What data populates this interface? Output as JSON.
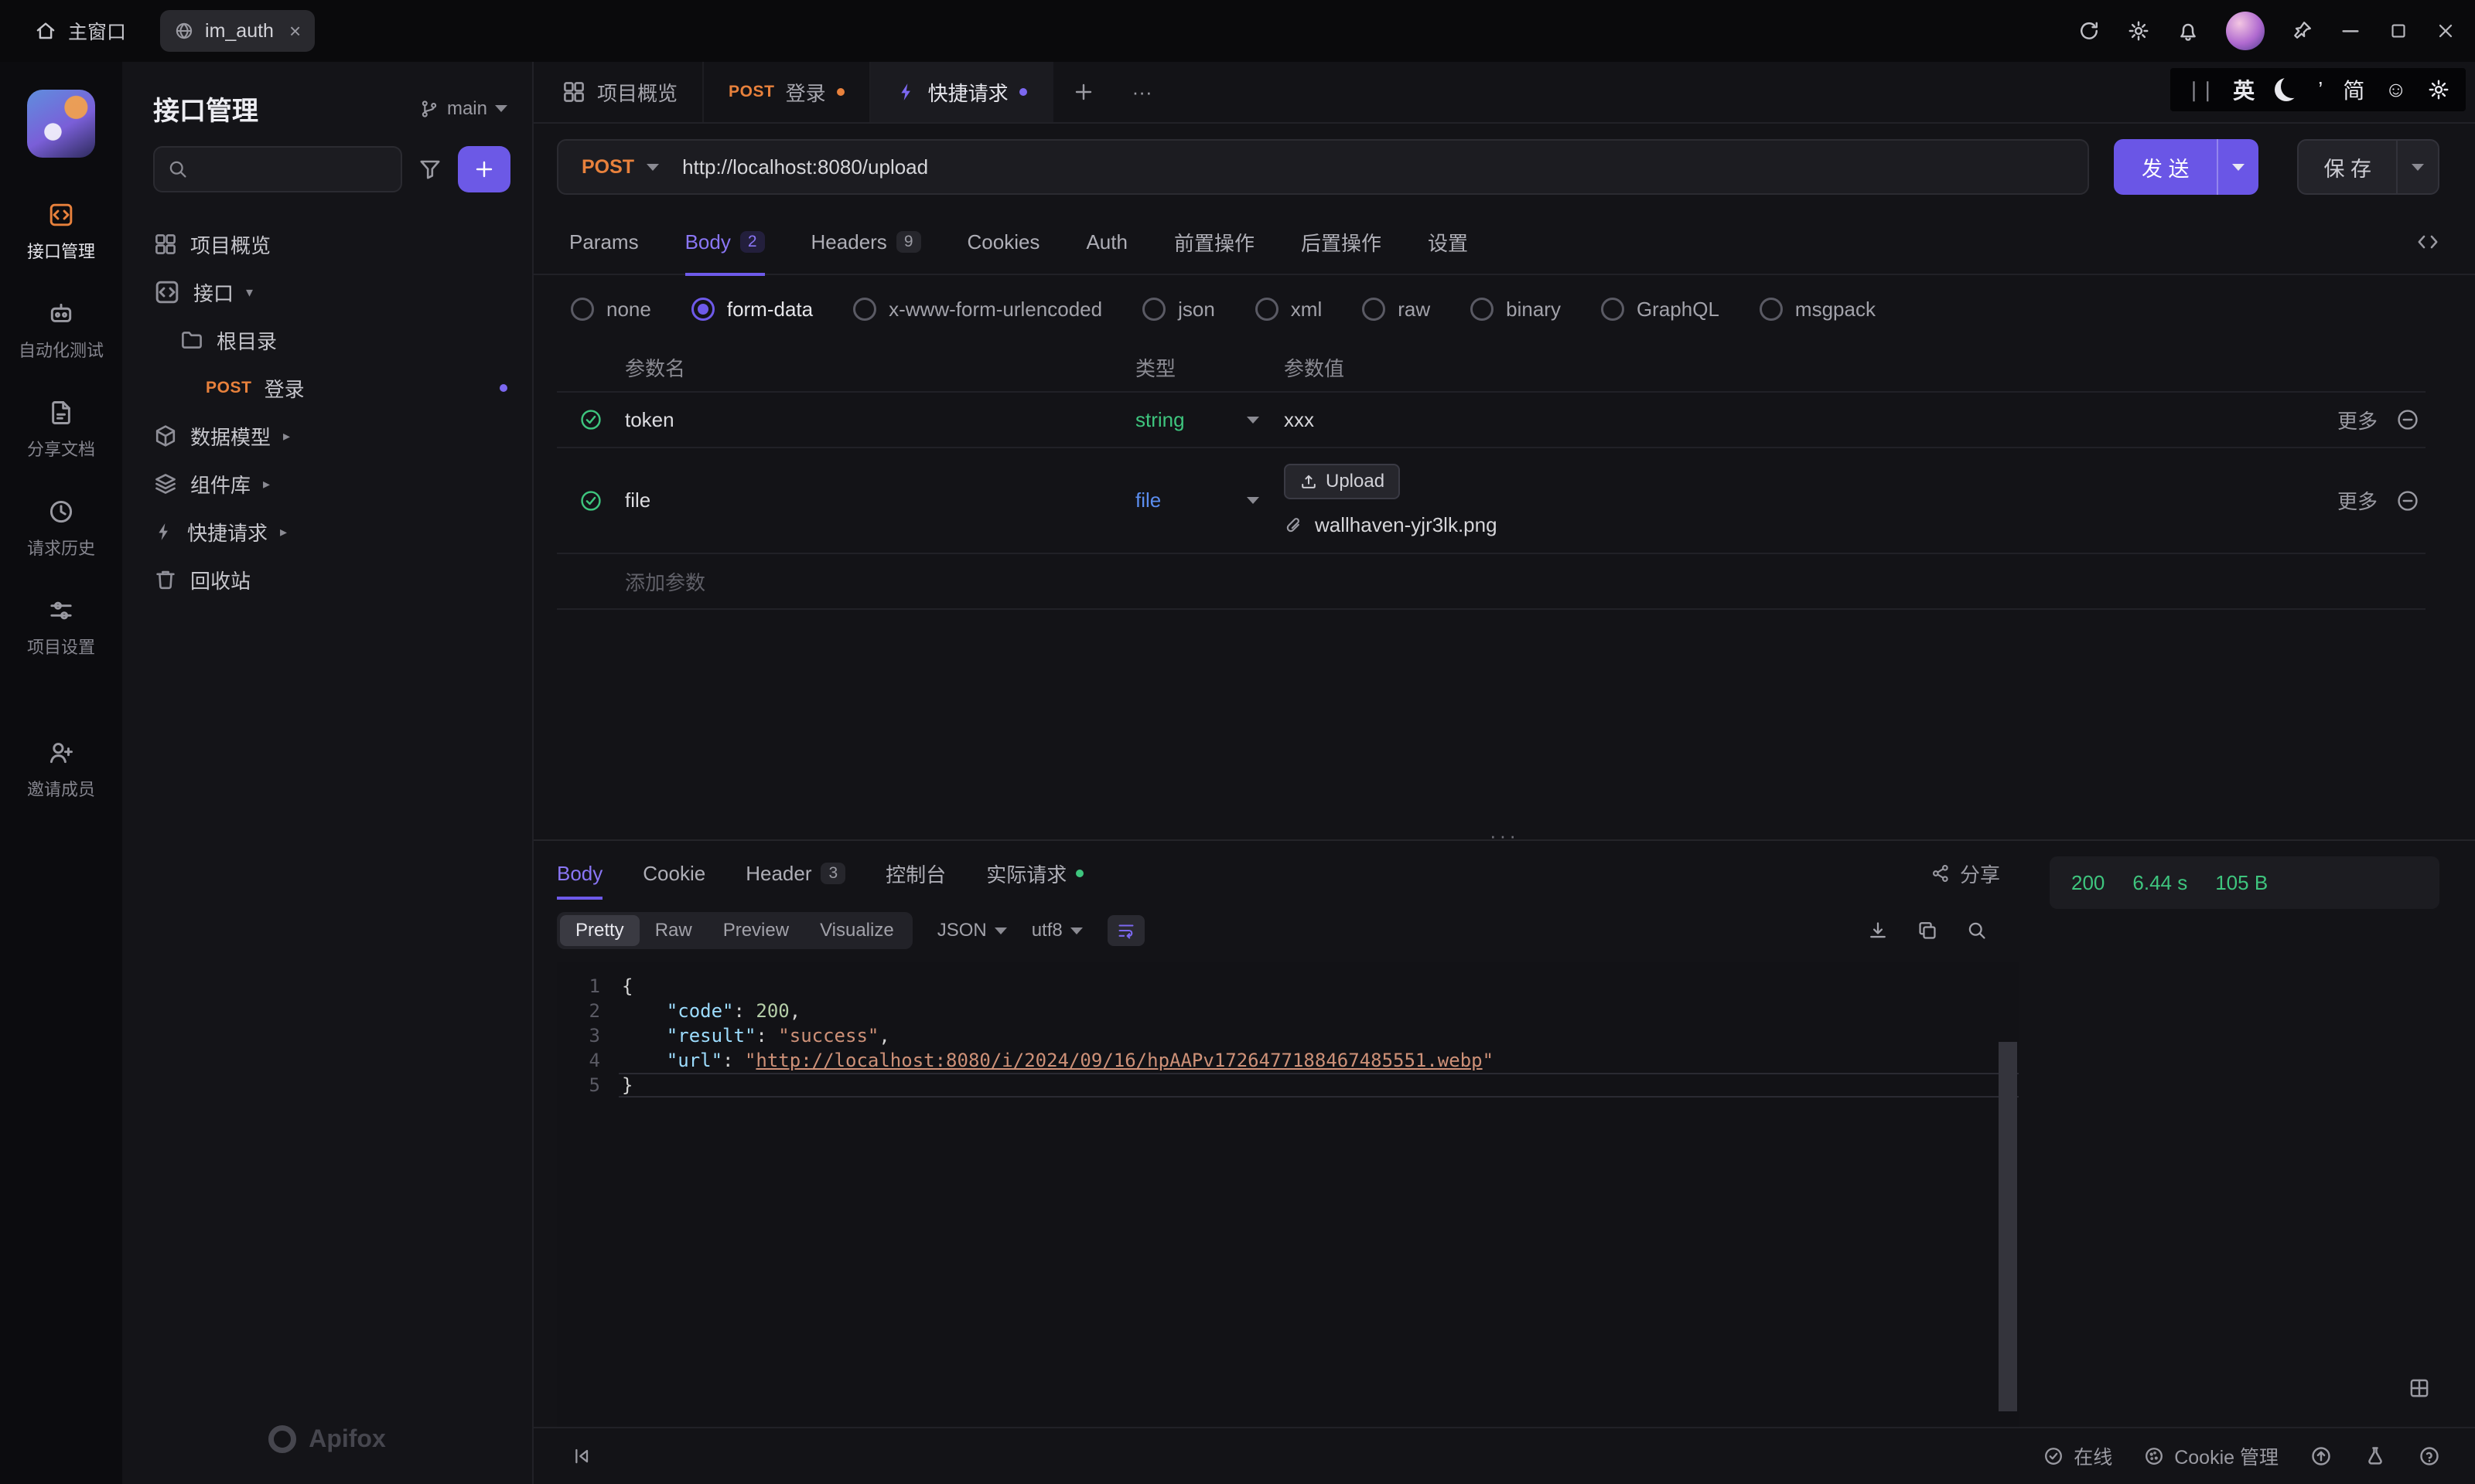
{
  "titlebar": {
    "home_label": "主窗口",
    "tab_label": "im_auth",
    "close_glyph": "×"
  },
  "ime": {
    "lang": "英",
    "apos": "’",
    "simp": "简",
    "smiley": "☺"
  },
  "rail": {
    "items": [
      {
        "label": "接口管理",
        "icon": "api",
        "active": true
      },
      {
        "label": "自动化测试",
        "icon": "robot",
        "active": false
      },
      {
        "label": "分享文档",
        "icon": "docshare",
        "active": false
      },
      {
        "label": "请求历史",
        "icon": "clock",
        "active": false
      },
      {
        "label": "项目设置",
        "icon": "sliders",
        "active": false
      },
      {
        "label": "邀请成员",
        "icon": "personplus",
        "active": false,
        "gapped": true
      }
    ]
  },
  "sidebar": {
    "title": "接口管理",
    "branch": "main",
    "tree": [
      {
        "label": "项目概览",
        "icon": "grid",
        "level": 0
      },
      {
        "label": "接口",
        "icon": "api",
        "level": 0,
        "caret": "down"
      },
      {
        "label": "根目录",
        "icon": "folder",
        "level": 1
      },
      {
        "label": "登录",
        "method": "POST",
        "level": 2,
        "dot": true
      },
      {
        "label": "数据模型",
        "icon": "cube",
        "level": 0,
        "caret": "right"
      },
      {
        "label": "组件库",
        "icon": "stack",
        "level": 0,
        "caret": "right"
      },
      {
        "label": "快捷请求",
        "icon": "bolt",
        "level": 0,
        "caret": "right"
      },
      {
        "label": "回收站",
        "icon": "trash",
        "level": 0
      }
    ],
    "logo_text": "Apifox"
  },
  "doc_tabs": {
    "tabs": [
      {
        "label": "项目概览",
        "icon": "grid"
      },
      {
        "label": "登录",
        "method": "POST",
        "dot": "orange"
      },
      {
        "label": "快捷请求",
        "icon": "bolt",
        "icon_color": "purple",
        "dot": "purple",
        "active": true
      }
    ]
  },
  "request": {
    "method": "POST",
    "url": "http://localhost:8080/upload",
    "send_label": "发 送",
    "save_label": "保 存"
  },
  "req_tabs": {
    "items": [
      {
        "label": "Params"
      },
      {
        "label": "Body",
        "badge": "2",
        "active": true
      },
      {
        "label": "Headers",
        "badge": "9"
      },
      {
        "label": "Cookies"
      },
      {
        "label": "Auth"
      },
      {
        "label": "前置操作"
      },
      {
        "label": "后置操作"
      },
      {
        "label": "设置"
      }
    ]
  },
  "body_types": {
    "options": [
      "none",
      "form-data",
      "x-www-form-urlencoded",
      "json",
      "xml",
      "raw",
      "binary",
      "GraphQL",
      "msgpack"
    ],
    "selected": "form-data"
  },
  "param_table": {
    "headers": [
      "参数名",
      "类型",
      "参数值"
    ],
    "more_label": "更多",
    "add_label": "添加参数",
    "rows": [
      {
        "name": "token",
        "type": "string",
        "type_color": "green",
        "value": "xxx"
      },
      {
        "name": "file",
        "type": "file",
        "type_color": "blue",
        "upload_label": "Upload",
        "file_name": "wallhaven-yjr3lk.png"
      }
    ]
  },
  "response": {
    "tabs": [
      {
        "label": "Body",
        "active": true
      },
      {
        "label": "Cookie"
      },
      {
        "label": "Header",
        "badge": "3"
      },
      {
        "label": "控制台"
      },
      {
        "label": "实际请求",
        "dot": "green"
      }
    ],
    "share_label": "分享",
    "status": {
      "code": "200",
      "time": "6.44 s",
      "size": "105 B"
    },
    "view_modes": [
      "Pretty",
      "Raw",
      "Preview",
      "Visualize"
    ],
    "active_mode": "Pretty",
    "format": "JSON",
    "encoding": "utf8",
    "code_lines": [
      {
        "num": 1,
        "current": false,
        "tokens": [
          {
            "c": "punc",
            "t": "{"
          }
        ]
      },
      {
        "num": 2,
        "current": false,
        "tokens": [
          {
            "c": "plain",
            "t": "    "
          },
          {
            "c": "key",
            "t": "\"code\""
          },
          {
            "c": "punc",
            "t": ": "
          },
          {
            "c": "num",
            "t": "200"
          },
          {
            "c": "punc",
            "t": ","
          }
        ]
      },
      {
        "num": 3,
        "current": false,
        "tokens": [
          {
            "c": "plain",
            "t": "    "
          },
          {
            "c": "key",
            "t": "\"result\""
          },
          {
            "c": "punc",
            "t": ": "
          },
          {
            "c": "str",
            "t": "\"success\""
          },
          {
            "c": "punc",
            "t": ","
          }
        ]
      },
      {
        "num": 4,
        "current": false,
        "tokens": [
          {
            "c": "plain",
            "t": "    "
          },
          {
            "c": "key",
            "t": "\"url\""
          },
          {
            "c": "punc",
            "t": ": "
          },
          {
            "c": "str",
            "t": "\""
          },
          {
            "c": "link",
            "t": "http://localhost:8080/i/2024/09/16/hpAAPv1726477188467485551.webp"
          },
          {
            "c": "str",
            "t": "\""
          }
        ]
      },
      {
        "num": 5,
        "current": true,
        "tokens": [
          {
            "c": "punc",
            "t": "}"
          }
        ]
      }
    ]
  },
  "statusbar": {
    "online_label": "在线",
    "cookie_label": "Cookie 管理"
  }
}
